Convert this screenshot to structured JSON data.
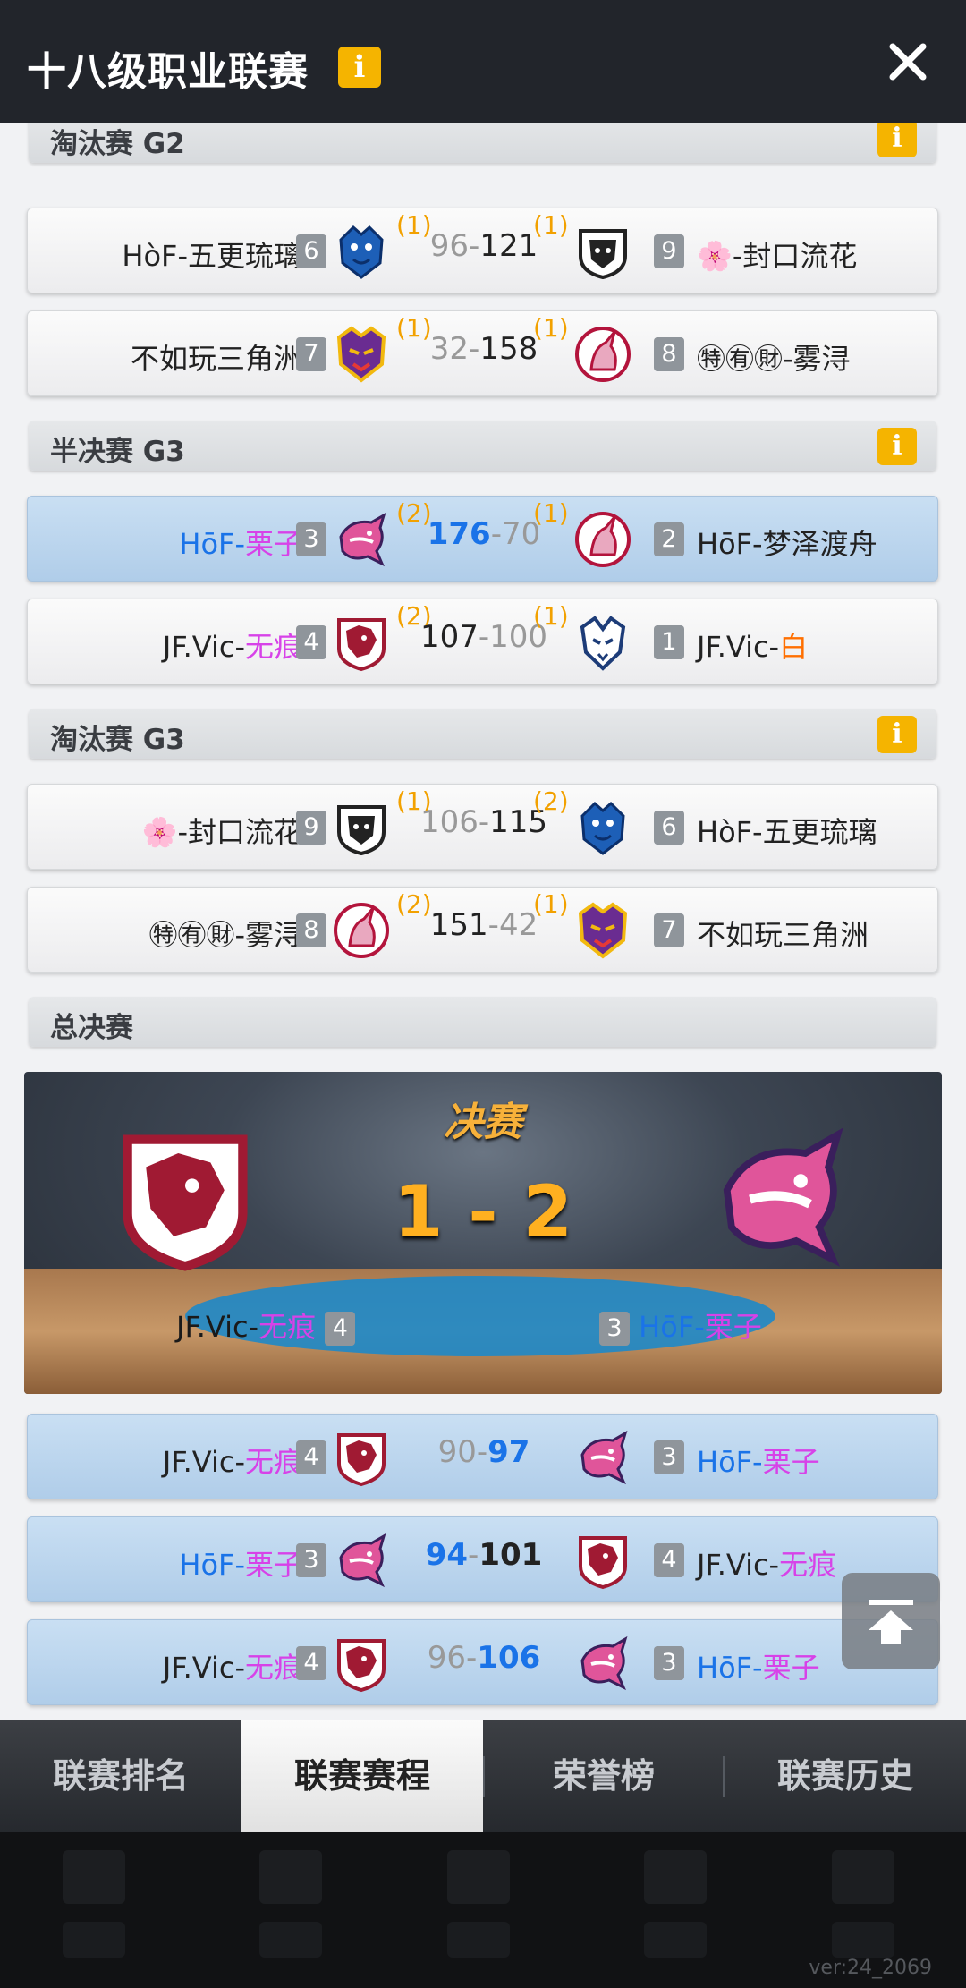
{
  "header": {
    "title": "十八级职业联赛",
    "info_icon": "info-icon",
    "close_icon": "close-icon"
  },
  "sections": {
    "s0": {
      "title": "淘汰赛 G2"
    },
    "s1": {
      "title": "半决赛 G3"
    },
    "s2": {
      "title": "淘汰赛 G3"
    },
    "s3": {
      "title": "总决赛"
    }
  },
  "rows": {
    "r0": {
      "left_name": "HòF-五更琉璃",
      "left_seed": "6",
      "left_wins": "(1)",
      "score_left": "96",
      "score_sep": "-",
      "score_right": "121",
      "right_wins": "(1)",
      "right_seed": "9",
      "right_name": "🌸-封口流花"
    },
    "r1": {
      "left_name": "不如玩三角洲",
      "left_seed": "7",
      "left_wins": "(1)",
      "score_left": "32",
      "score_sep": "-",
      "score_right": "158",
      "right_wins": "(1)",
      "right_seed": "8",
      "right_name": "㊕㊒㊖-雾浔"
    },
    "r2": {
      "left_pre": "HōF-",
      "left_post": "栗子",
      "left_seed": "3",
      "left_wins": "(2)",
      "score_left": "176",
      "score_sep": "-",
      "score_right": "70",
      "right_wins": "(1)",
      "right_seed": "2",
      "right_name": "HōF-梦泽渡舟"
    },
    "r3": {
      "left_pre": "JF.Vic-",
      "left_post": "无痕",
      "left_seed": "4",
      "left_wins": "(2)",
      "score_left": "107",
      "score_sep": "-",
      "score_right": "100",
      "right_wins": "(1)",
      "right_seed": "1",
      "right_pre": "JF.Vic-",
      "right_post": "白"
    },
    "r4": {
      "left_name": "🌸-封口流花",
      "left_seed": "9",
      "left_wins": "(1)",
      "score_left": "106",
      "score_sep": "-",
      "score_right": "115",
      "right_wins": "(2)",
      "right_seed": "6",
      "right_name": "HòF-五更琉璃"
    },
    "r5": {
      "left_name": "㊕㊒㊖-雾浔",
      "left_seed": "8",
      "left_wins": "(2)",
      "score_left": "151",
      "score_sep": "-",
      "score_right": "42",
      "right_wins": "(1)",
      "right_seed": "7",
      "right_name": "不如玩三角洲"
    },
    "f0": {
      "left_pre": "JF.Vic-",
      "left_post": "无痕",
      "left_seed": "4",
      "score_left": "90",
      "score_sep": "-",
      "score_right": "97",
      "right_seed": "3",
      "right_pre": "HōF-",
      "right_post": "栗子"
    },
    "f1": {
      "left_pre": "HōF-",
      "left_post": "栗子",
      "left_seed": "3",
      "score_left": "94",
      "score_sep": "-",
      "score_right": "101",
      "right_seed": "4",
      "right_pre": "JF.Vic-",
      "right_post": "无痕"
    },
    "f2": {
      "left_pre": "JF.Vic-",
      "left_post": "无痕",
      "left_seed": "4",
      "score_left": "96",
      "score_sep": "-",
      "score_right": "106",
      "right_seed": "3",
      "right_pre": "HōF-",
      "right_post": "栗子"
    }
  },
  "final_banner": {
    "title": "决赛",
    "series_score": "1 - 2",
    "left_pre": "JF.Vic-",
    "left_post": "无痕",
    "left_seed": "4",
    "right_seed": "3",
    "right_pre": "HōF-",
    "right_post": "栗子"
  },
  "tabs": {
    "t0": "联赛排名",
    "t1": "联赛赛程",
    "t2": "荣誉榜",
    "t3": "联赛历史",
    "active": "联赛赛程"
  },
  "version": "ver:24_2069",
  "colors": {
    "accent": "#f5b400",
    "hof_blue": "#1a73e8",
    "name_purple": "#d742e8",
    "wins_orange": "#f2a100",
    "highlight_row": "#c9dff3"
  },
  "logos": {
    "bear": "blue-bear-logo",
    "lion": "lion-crest-logo",
    "tiger": "purple-tiger-logo",
    "unicorn": "unicorn-badge-logo",
    "shark": "pink-shark-logo",
    "dragon": "red-dragon-logo",
    "wolf": "white-wolf-logo"
  }
}
